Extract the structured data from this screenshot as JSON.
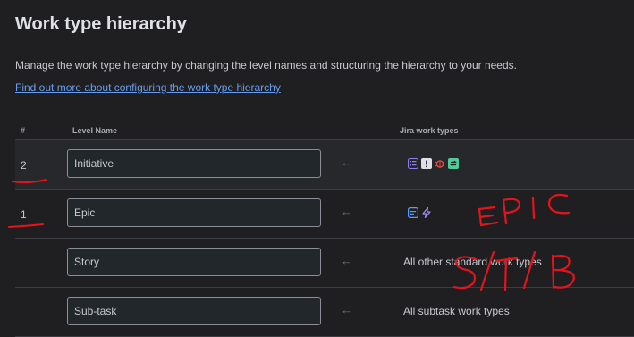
{
  "page": {
    "title": "Work type hierarchy",
    "description": "Manage the work type hierarchy by changing the level names and structuring the hierarchy to your needs.",
    "link": "Find out more about configuring the work type hierarchy"
  },
  "table": {
    "headers": {
      "num": "#",
      "level_name": "Level Name",
      "work_types": "Jira work types"
    },
    "rows": [
      {
        "num": "2",
        "level_name": "Initiative",
        "work_types_text": "",
        "icons": [
          "subtask-list-icon",
          "warning-icon",
          "bug-icon",
          "change-icon"
        ]
      },
      {
        "num": "1",
        "level_name": "Epic",
        "work_types_text": "",
        "icons": [
          "story-icon",
          "epic-icon"
        ]
      },
      {
        "num": "",
        "level_name": "Story",
        "work_types_text": "All other standard work types",
        "icons": []
      },
      {
        "num": "",
        "level_name": "Sub-task",
        "work_types_text": "All subtask work types",
        "icons": []
      }
    ]
  },
  "annotations": {
    "epic": "EPIC",
    "stb": "S/T/B"
  },
  "colors": {
    "background": "#1f1f21",
    "link": "#669df1",
    "annotation": "#e3141b"
  }
}
